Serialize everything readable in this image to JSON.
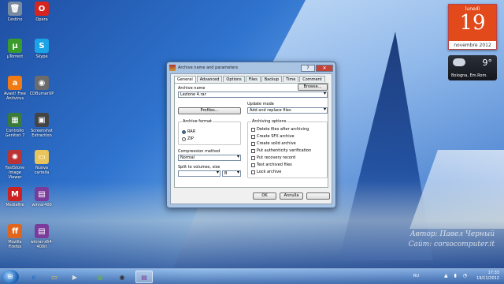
{
  "desktop_icons": [
    {
      "label": "Cestino",
      "icon": "recycle-bin-icon",
      "color": "#7a8aa0",
      "glyph": "🗑"
    },
    {
      "label": "Opera",
      "icon": "opera-icon",
      "color": "#d8241f",
      "glyph": "O"
    },
    {
      "label": "µTorrent",
      "icon": "utorrent-icon",
      "color": "#3a9b2c",
      "glyph": "µ"
    },
    {
      "label": "Skype",
      "icon": "skype-icon",
      "color": "#1aa3e6",
      "glyph": "S"
    },
    {
      "label": "Avast! Free Antivirus",
      "icon": "avast-icon",
      "color": "#f07a14",
      "glyph": "a"
    },
    {
      "label": "CDBurnerXP",
      "icon": "cd-icon",
      "color": "#6b6b6b",
      "glyph": "◉"
    },
    {
      "label": "Controllo Genitori 7",
      "icon": "parental-icon",
      "color": "#3a7a3a",
      "glyph": "▦"
    },
    {
      "label": "Screenshot Extraction",
      "icon": "screenshot-icon",
      "color": "#444",
      "glyph": "▣"
    },
    {
      "label": "FastStone Image Viewer",
      "icon": "faststone-icon",
      "color": "#b33",
      "glyph": "✺"
    },
    {
      "label": "Nuova cartella",
      "icon": "folder-icon",
      "color": "#e8c45a",
      "glyph": "▭"
    },
    {
      "label": "Mediafire",
      "icon": "mediafire-icon",
      "color": "#c22",
      "glyph": "M"
    },
    {
      "label": "winrar400",
      "icon": "winrar-icon",
      "color": "#7a3b9a",
      "glyph": "▤"
    },
    {
      "label": "Mozilla Firefox",
      "icon": "firefox-icon",
      "color": "#e0661d",
      "glyph": "ff"
    },
    {
      "label": "winrar-x64-400it",
      "icon": "winrar-icon",
      "color": "#7a3b9a",
      "glyph": "▤"
    }
  ],
  "calendar": {
    "weekday": "lunedì",
    "day": "19",
    "month": "novembre 2012"
  },
  "weather": {
    "temp": "9°",
    "city": "Bologna, Em.Rom."
  },
  "dialog": {
    "title": "Archive name and parameters",
    "tabs": [
      "General",
      "Advanced",
      "Options",
      "Files",
      "Backup",
      "Time",
      "Comment"
    ],
    "archive_name_label": "Archive name",
    "browse_button": "Browse...",
    "archive_name_value": "Lezione 4.rar",
    "profiles_button": "Profiles...",
    "update_mode_label": "Update mode",
    "update_mode_value": "Add and replace files",
    "archive_format_label": "Archive format",
    "formats": [
      "RAR",
      "ZIP"
    ],
    "archiving_options_label": "Archiving options",
    "options": [
      "Delete files after archiving",
      "Create SFX archive",
      "Create solid archive",
      "Put authenticity verification",
      "Put recovery record",
      "Test archived files",
      "Lock archive"
    ],
    "compression_label": "Compression method",
    "compression_value": "Normal",
    "split_label": "Split to volumes, size",
    "split_unit": "B",
    "ok_button": "OK",
    "cancel_button": "Annulla",
    "help_button": "?"
  },
  "watermark": {
    "line1": "Автор: Павел Черный",
    "line2": "Сайт: corsocomputer.it"
  },
  "taskbar": {
    "lang": "RU",
    "time": "17:33",
    "date": "19/11/2012"
  }
}
